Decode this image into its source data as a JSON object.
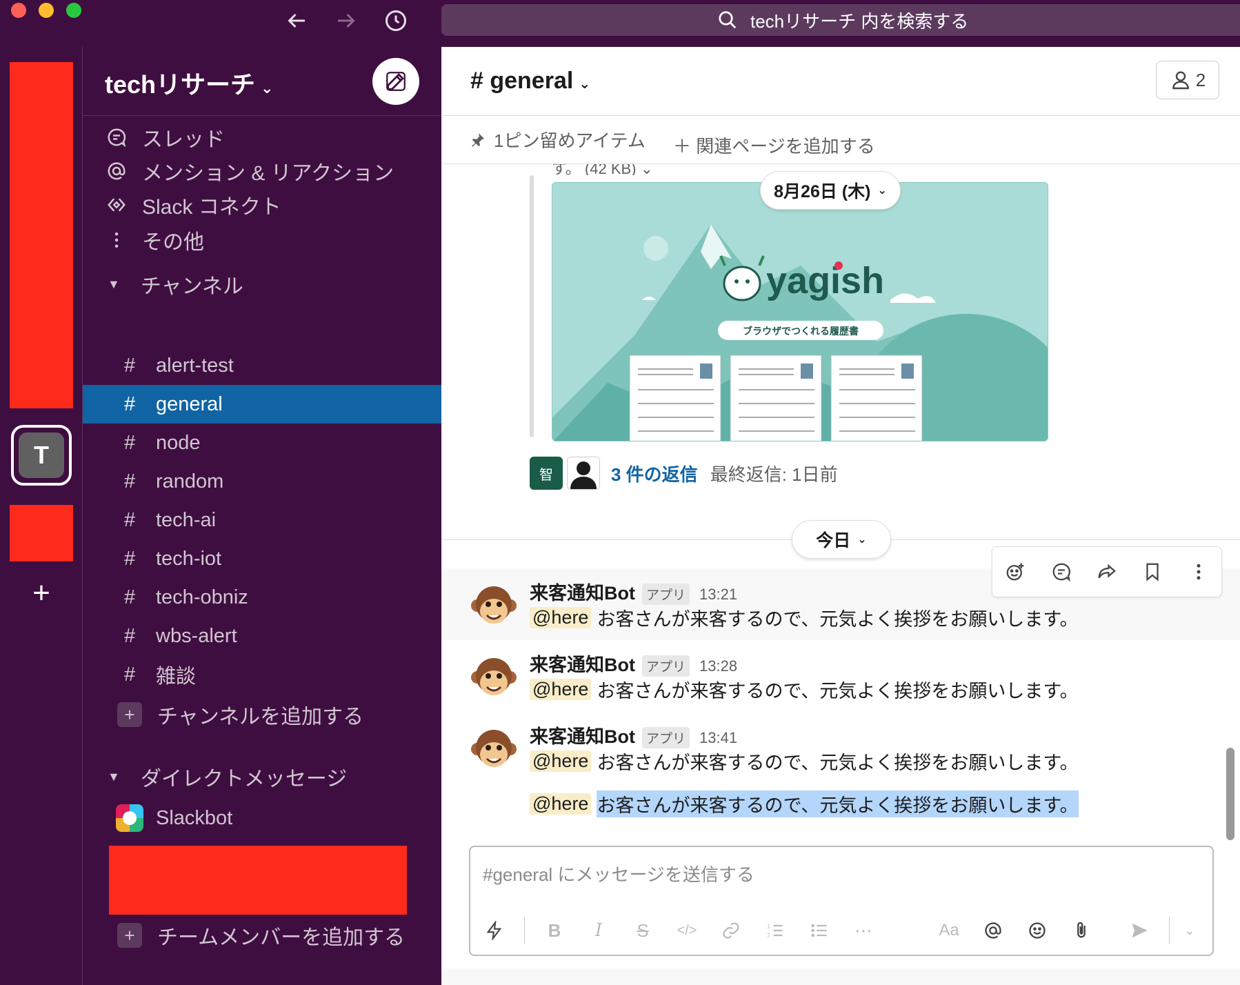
{
  "search": {
    "text": "techリサーチ 内を検索する"
  },
  "rail": {
    "workspace_initial": "T",
    "add_label": "+"
  },
  "workspace": {
    "name": "techリサーチ",
    "caret": "⌄"
  },
  "nav": {
    "threads": "スレッド",
    "mentions": "メンション & リアクション",
    "connect": "Slack コネクト",
    "more": "その他"
  },
  "channels_section": {
    "label": "チャンネル",
    "add_label": "チャンネルを追加する"
  },
  "channels": [
    {
      "name": "alert-test",
      "active": false
    },
    {
      "name": "general",
      "active": true
    },
    {
      "name": "node",
      "active": false
    },
    {
      "name": "random",
      "active": false
    },
    {
      "name": "tech-ai",
      "active": false
    },
    {
      "name": "tech-iot",
      "active": false
    },
    {
      "name": "tech-obniz",
      "active": false
    },
    {
      "name": "wbs-alert",
      "active": false
    },
    {
      "name": "雑談",
      "active": false
    }
  ],
  "dm_section": {
    "label": "ダイレクトメッセージ",
    "add_label": "チームメンバーを追加する"
  },
  "dms": [
    {
      "name": "Slackbot"
    }
  ],
  "channel_header": {
    "title": "# general",
    "member_count": "2"
  },
  "bookmarks": {
    "pinned": "1ピン留めアイテム",
    "add_page": "＋ 関連ページを追加する"
  },
  "cut_text": "す。 (42 KB) ⌄",
  "date_dividers": {
    "previous": "8月26日 (木)",
    "today": "今日"
  },
  "banner": {
    "brand": "yagish",
    "tagline": "ブラウザでつくれる履歴書"
  },
  "thread_summary": {
    "avatar_char": "智",
    "replies": "3 件の返信",
    "last_reply": "最終返信: 1日前"
  },
  "messages": [
    {
      "sender": "来客通知Bot",
      "badge": "アプリ",
      "time": "13:21",
      "mention": "@here",
      "text": "お客さんが来客するので、元気よく挨拶をお願いします。"
    },
    {
      "sender": "来客通知Bot",
      "badge": "アプリ",
      "time": "13:28",
      "mention": "@here",
      "text": "お客さんが来客するので、元気よく挨拶をお願いします。"
    },
    {
      "sender": "来客通知Bot",
      "badge": "アプリ",
      "time": "13:41",
      "mention": "@here",
      "text": "お客さんが来客するので、元気よく挨拶をお願いします。"
    }
  ],
  "continuation": {
    "mention": "@here",
    "text": "お客さんが来客するので、元気よく挨拶をお願いします。"
  },
  "composer": {
    "placeholder": "#general にメッセージを送信する"
  },
  "colors": {
    "sidebar": "#3f0e40",
    "active": "#1164a3",
    "mention_bg": "#f9edc9",
    "selection": "#b4d6fb"
  }
}
